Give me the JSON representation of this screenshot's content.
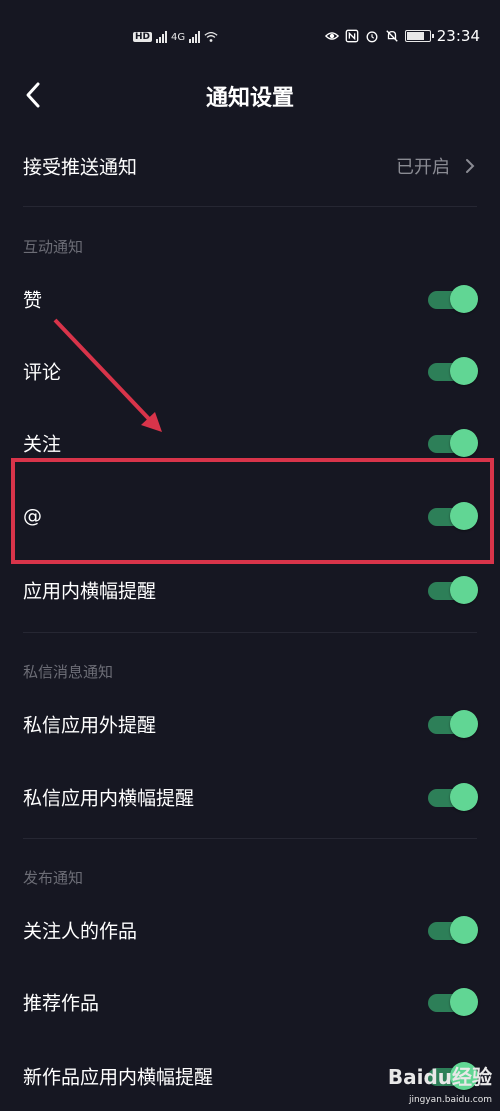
{
  "status_bar": {
    "hd_badge": "HD",
    "network": "4G",
    "time": "23:34"
  },
  "header": {
    "title": "通知设置"
  },
  "push": {
    "label": "接受推送通知",
    "value": "已开启"
  },
  "sections": {
    "interaction": {
      "title": "互动通知",
      "items": [
        {
          "label": "赞",
          "on": true
        },
        {
          "label": "评论",
          "on": true
        },
        {
          "label": "关注",
          "on": true
        },
        {
          "label": "@",
          "on": true
        },
        {
          "label": "应用内横幅提醒",
          "on": true
        }
      ]
    },
    "messages": {
      "title": "私信消息通知",
      "items": [
        {
          "label": "私信应用外提醒",
          "on": true
        },
        {
          "label": "私信应用内横幅提醒",
          "on": true
        }
      ]
    },
    "publish": {
      "title": "发布通知",
      "items": [
        {
          "label": "关注人的作品",
          "on": true
        },
        {
          "label": "推荐作品",
          "on": true
        },
        {
          "label": "新作品应用内横幅提醒",
          "on": true
        }
      ]
    }
  },
  "watermark": {
    "brand": "Baidu经验",
    "url": "jingyan.baidu.com"
  },
  "colors": {
    "background": "#161722",
    "toggle_on": "#61d694",
    "highlight": "#d8344a"
  }
}
